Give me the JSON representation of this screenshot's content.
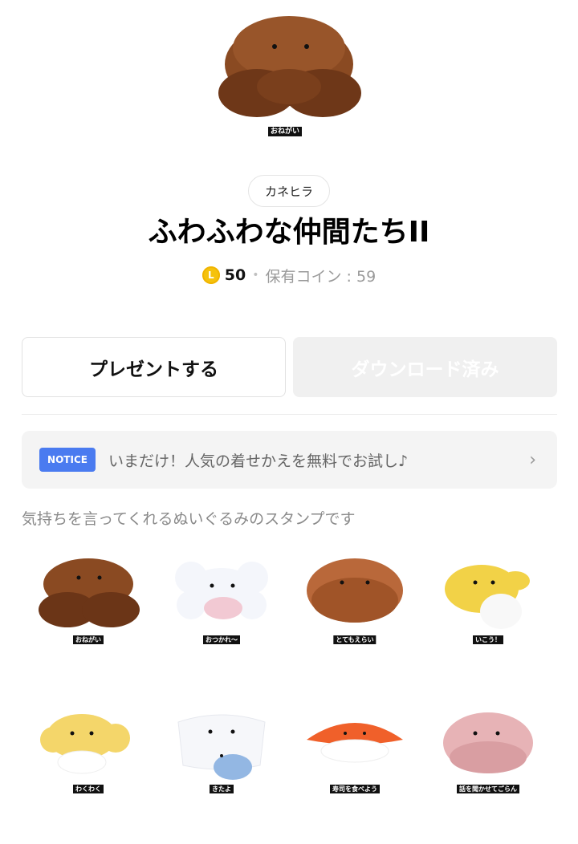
{
  "hero": {
    "caption": "おねがい"
  },
  "author": {
    "name": "カネヒラ"
  },
  "title": "ふわふわな仲間たちII",
  "price": {
    "coin_glyph": "L",
    "amount": "50",
    "separator": "•",
    "owned_label": "保有コイン : 59"
  },
  "buttons": {
    "gift_label": "プレゼントする",
    "download_label": "ダウンロード済み"
  },
  "notice": {
    "badge": "NOTICE",
    "text": "いまだけ！人気の着せかえを無料でお試し♪",
    "chevron": "›"
  },
  "description": "気持ちを言ってくれるぬいぐるみのスタンプです",
  "stickers": [
    {
      "caption": "おねがい",
      "colors": [
        "#8a4a22",
        "#6b3517"
      ]
    },
    {
      "caption": "おつかれ〜",
      "colors": [
        "#f4f6fb",
        "#f2c9d3"
      ]
    },
    {
      "caption": "とてもえらい",
      "colors": [
        "#b9683a",
        "#a05428"
      ]
    },
    {
      "caption": "いこう！",
      "colors": [
        "#f2d247",
        "#f8f8f8"
      ]
    },
    {
      "caption": "わくわく",
      "colors": [
        "#f4d66a",
        "#ffffff"
      ]
    },
    {
      "caption": "きたよ",
      "colors": [
        "#f6f7fa",
        "#93b7e3"
      ]
    },
    {
      "caption": "寿司を食べよう",
      "colors": [
        "#f0602a",
        "#ffffff"
      ]
    },
    {
      "caption": "話を聞かせてごらん",
      "colors": [
        "#e7b3b6",
        "#d99ea2"
      ]
    }
  ],
  "colors": {
    "notice_badge": "#4a7bf0",
    "coin": "#f5c20d"
  }
}
